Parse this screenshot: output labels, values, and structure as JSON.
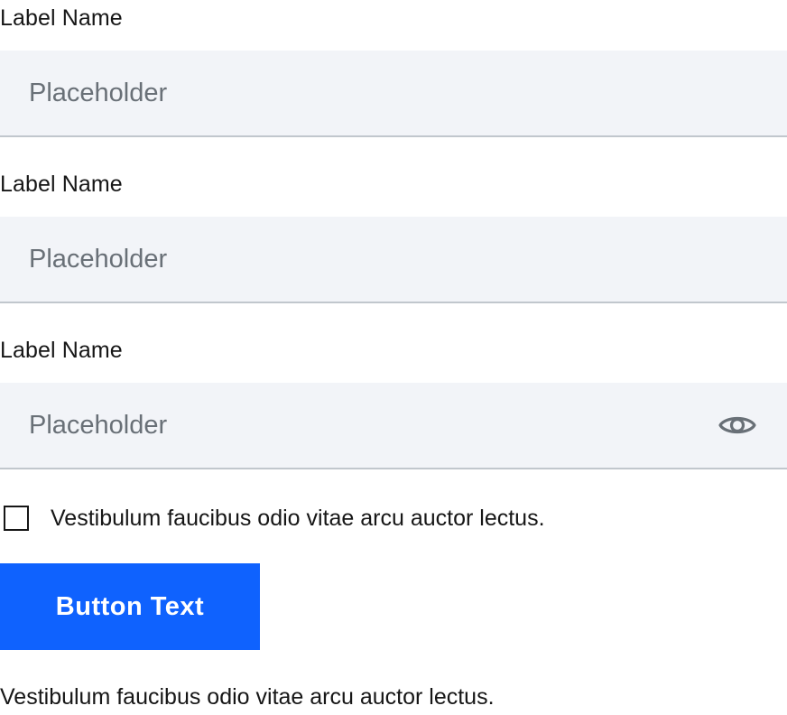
{
  "form": {
    "fields": [
      {
        "label": "Label Name",
        "placeholder": "Placeholder",
        "value": ""
      },
      {
        "label": "Label Name",
        "placeholder": "Placeholder",
        "value": ""
      },
      {
        "label": "Label Name",
        "placeholder": "Placeholder",
        "value": "",
        "trailing_icon": "eye-icon"
      }
    ],
    "checkbox": {
      "label": "Vestibulum faucibus odio vitae arcu auctor lectus.",
      "checked": false
    },
    "submit_label": "Button Text",
    "footnote": "Vestibulum faucibus odio vitae arcu auctor lectus."
  },
  "colors": {
    "field_background": "#f2f4f8",
    "field_border": "#c1c7cd",
    "placeholder": "#697077",
    "text": "#161616",
    "primary": "#0f62fe",
    "icon": "#697077"
  }
}
